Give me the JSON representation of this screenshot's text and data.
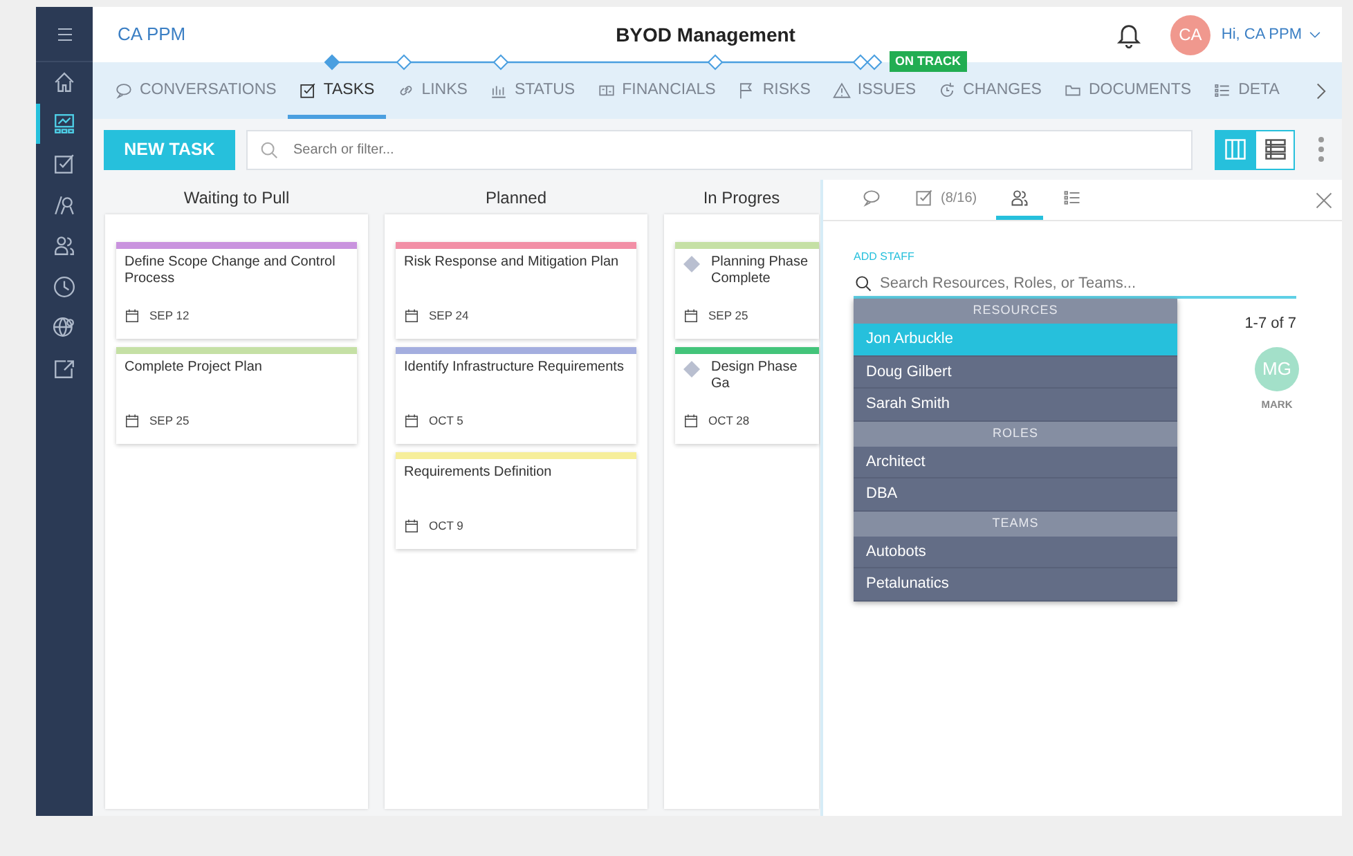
{
  "app": {
    "brand": "CA PPM",
    "title": "BYOD Management",
    "user_initials": "CA",
    "user_greeting": "Hi, CA PPM"
  },
  "milestones": {
    "points": [
      {
        "reached": true
      },
      {
        "reached": false
      },
      {
        "reached": false
      },
      {
        "reached": false
      },
      {
        "reached": false
      },
      {
        "reached": false
      }
    ],
    "badge": "ON TRACK"
  },
  "sidebar": {
    "items": [
      {
        "kind": "home",
        "selected": false
      },
      {
        "kind": "dashboard",
        "selected": true
      },
      {
        "kind": "check",
        "selected": false
      },
      {
        "kind": "award",
        "selected": false
      },
      {
        "kind": "people",
        "selected": false
      },
      {
        "kind": "clock",
        "selected": false
      },
      {
        "kind": "globe",
        "selected": false
      },
      {
        "kind": "export",
        "selected": false
      }
    ]
  },
  "tabs": [
    {
      "label": "CONVERSATIONS",
      "kind": "comment",
      "selected": false
    },
    {
      "label": "TASKS",
      "kind": "check",
      "selected": true
    },
    {
      "label": "LINKS",
      "kind": "link",
      "selected": false
    },
    {
      "label": "STATUS",
      "kind": "chart",
      "selected": false
    },
    {
      "label": "FINANCIALS",
      "kind": "money",
      "selected": false
    },
    {
      "label": "RISKS",
      "kind": "flag",
      "selected": false
    },
    {
      "label": "ISSUES",
      "kind": "warning",
      "selected": false
    },
    {
      "label": "CHANGES",
      "kind": "changes",
      "selected": false
    },
    {
      "label": "DOCUMENTS",
      "kind": "folder",
      "selected": false
    },
    {
      "label": "DETA",
      "kind": "listing",
      "selected": false
    }
  ],
  "toolbar": {
    "new_task": "NEW TASK",
    "search": {
      "placeholder": "Search or filter..."
    },
    "views": [
      {
        "kind": "board",
        "selected": true
      },
      {
        "kind": "rows",
        "selected": false
      }
    ]
  },
  "board": {
    "columns": [
      {
        "title": "Waiting to Pull",
        "cards": [
          {
            "kind": "task",
            "title": "Define Scope Change and Control Process",
            "date": "SEP 12",
            "color": "#c993de"
          },
          {
            "kind": "task",
            "title": "Complete Project Plan",
            "date": "SEP 25",
            "color": "#c5e0a5"
          }
        ]
      },
      {
        "title": "Planned",
        "cards": [
          {
            "kind": "task",
            "title": "Risk Response and Mitigation Plan",
            "date": "SEP 24",
            "color": "#f28fa6"
          },
          {
            "kind": "task",
            "title": "Identify Infrastructure Requirements",
            "date": "OCT 5",
            "color": "#a4aedf"
          },
          {
            "kind": "task",
            "title": "Requirements Definition",
            "date": "OCT 9",
            "color": "#f6ee9a"
          }
        ]
      },
      {
        "title": "In Progres",
        "cards": [
          {
            "kind": "milestone",
            "title": "Planning Phase Complete",
            "date": "SEP 25",
            "color": "#c5e0a5"
          },
          {
            "kind": "milestone",
            "title": "Design Phase Ga",
            "date": "OCT 28",
            "color": "#43c47a"
          }
        ]
      }
    ]
  },
  "panel": {
    "tabs": [
      {
        "kind": "comment",
        "selected": false
      },
      {
        "kind": "check",
        "label": "(8/16)",
        "selected": false
      },
      {
        "kind": "people",
        "selected": true
      },
      {
        "kind": "listing",
        "selected": false
      }
    ],
    "staff": {
      "label": "ADD STAFF",
      "placeholder": "Search Resources, Roles, or Teams...",
      "groups": [
        {
          "heading": "RESOURCES",
          "items": [
            {
              "label": "Jon Arbuckle",
              "selected": true
            },
            {
              "label": "Doug Gilbert",
              "selected": false
            },
            {
              "label": "Sarah Smith",
              "selected": false
            }
          ]
        },
        {
          "heading": "ROLES",
          "items": [
            {
              "label": "Architect",
              "selected": false
            },
            {
              "label": "DBA",
              "selected": false
            }
          ]
        },
        {
          "heading": "TEAMS",
          "items": [
            {
              "label": "Autobots",
              "selected": false
            },
            {
              "label": "Petalunatics",
              "selected": false
            }
          ]
        }
      ],
      "count": "1-7 of 7",
      "members": [
        {
          "initials": "MG",
          "name": "MARK",
          "color": "#a3e0c9"
        }
      ]
    }
  }
}
